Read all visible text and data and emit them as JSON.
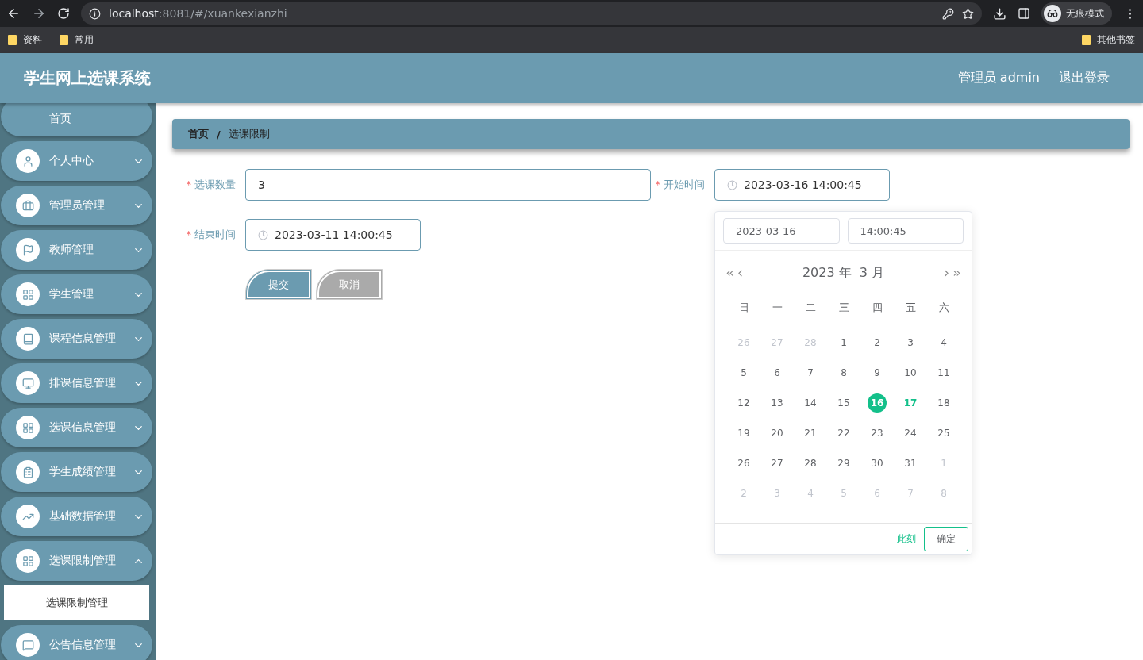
{
  "browser": {
    "url_host": "localhost",
    "url_rest": ":8081/#/xuankexianzhi",
    "profile": "无痕模式",
    "bookmarks": [
      "资料",
      "常用"
    ],
    "other_bookmarks": "其他书签"
  },
  "header": {
    "title": "学生网上选课系统",
    "user": "管理员 admin",
    "logout": "退出登录"
  },
  "sidebar": {
    "items": [
      {
        "label": "首页",
        "kind": "link"
      },
      {
        "label": "个人中心",
        "kind": "menu",
        "expanded": false
      },
      {
        "label": "管理员管理",
        "kind": "menu",
        "expanded": false
      },
      {
        "label": "教师管理",
        "kind": "menu",
        "expanded": false
      },
      {
        "label": "学生管理",
        "kind": "menu",
        "expanded": false
      },
      {
        "label": "课程信息管理",
        "kind": "menu",
        "expanded": false
      },
      {
        "label": "排课信息管理",
        "kind": "menu",
        "expanded": false
      },
      {
        "label": "选课信息管理",
        "kind": "menu",
        "expanded": false
      },
      {
        "label": "学生成绩管理",
        "kind": "menu",
        "expanded": false
      },
      {
        "label": "基础数据管理",
        "kind": "menu",
        "expanded": false
      },
      {
        "label": "选课限制管理",
        "kind": "menu",
        "expanded": true,
        "children": [
          {
            "label": "选课限制管理",
            "selected": true
          }
        ]
      },
      {
        "label": "公告信息管理",
        "kind": "menu",
        "expanded": false
      }
    ]
  },
  "breadcrumb": [
    "首页",
    "选课限制"
  ],
  "breadcrumb_separator": "/",
  "form": {
    "fields": [
      {
        "label": "选课数量",
        "required_mark": "*",
        "kind": "text",
        "value": "3"
      },
      {
        "label": "开始时间",
        "required_mark": "*",
        "kind": "datetime",
        "value": "2023-03-16 14:00:45"
      },
      {
        "label": "结束时间",
        "required_mark": "*",
        "kind": "datetime",
        "value": "2023-03-11 14:00:45"
      }
    ],
    "buttons": [
      {
        "label": "提交",
        "kind": "primary"
      },
      {
        "label": "取消",
        "kind": "cancel"
      }
    ]
  },
  "date_picker": {
    "date_value": "2023-03-16",
    "time_value": "14:00:45",
    "month_title": "2023 年  3 月",
    "weekdays": [
      "日",
      "一",
      "二",
      "三",
      "四",
      "五",
      "六"
    ],
    "weeks": [
      [
        {
          "day": "26",
          "muted": true
        },
        {
          "day": "27",
          "muted": true
        },
        {
          "day": "28",
          "muted": true
        },
        {
          "day": "1"
        },
        {
          "day": "2"
        },
        {
          "day": "3"
        },
        {
          "day": "4"
        }
      ],
      [
        {
          "day": "5"
        },
        {
          "day": "6"
        },
        {
          "day": "7"
        },
        {
          "day": "8"
        },
        {
          "day": "9"
        },
        {
          "day": "10"
        },
        {
          "day": "11"
        }
      ],
      [
        {
          "day": "12"
        },
        {
          "day": "13"
        },
        {
          "day": "14"
        },
        {
          "day": "15"
        },
        {
          "day": "16",
          "selected": true
        },
        {
          "day": "17",
          "today": true
        },
        {
          "day": "18"
        }
      ],
      [
        {
          "day": "19"
        },
        {
          "day": "20"
        },
        {
          "day": "21"
        },
        {
          "day": "22"
        },
        {
          "day": "23"
        },
        {
          "day": "24"
        },
        {
          "day": "25"
        }
      ],
      [
        {
          "day": "26"
        },
        {
          "day": "27"
        },
        {
          "day": "28"
        },
        {
          "day": "29"
        },
        {
          "day": "30"
        },
        {
          "day": "31"
        },
        {
          "day": "1",
          "muted": true
        }
      ],
      [
        {
          "day": "2",
          "muted": true
        },
        {
          "day": "3",
          "muted": true
        },
        {
          "day": "4",
          "muted": true
        },
        {
          "day": "5",
          "muted": true
        },
        {
          "day": "6",
          "muted": true
        },
        {
          "day": "7",
          "muted": true
        },
        {
          "day": "8",
          "muted": true
        }
      ]
    ],
    "now_button": "此刻",
    "confirm_button": "确定"
  }
}
